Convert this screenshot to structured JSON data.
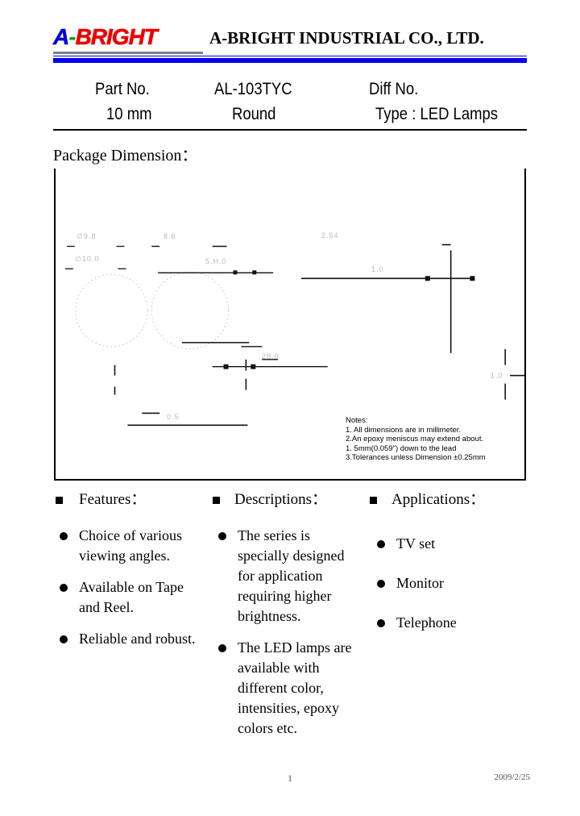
{
  "header": {
    "logo": {
      "part_a": "A",
      "dash": "-",
      "part_bright": "BRIGHT"
    },
    "company_name": "A-BRIGHT INDUSTRIAL CO., LTD."
  },
  "part_info": {
    "row1": {
      "label_part_no": "Part No.",
      "part_number": "AL-103TYC",
      "label_diff_no": "Diff No."
    },
    "row2": {
      "size": "10 mm",
      "shape": "Round",
      "type": "Type : LED Lamps"
    }
  },
  "section": {
    "package_dimension_title": "Package Dimension："
  },
  "drawing": {
    "dim_labels": [
      "∅9.8",
      "∅10.0",
      "8.6",
      "5.H.0",
      "2.54",
      "28.0",
      "1.0",
      "0.5",
      "1.0"
    ],
    "notes": {
      "title": "Notes:",
      "lines": [
        "1. All dimensions are in millimeter.",
        "2.An epoxy meniscus may extend about.",
        "  1. 5mm(0.059\") down to the lead",
        "3.Tolerances unless Dimension ±0.25mm"
      ]
    }
  },
  "columns": {
    "features": {
      "heading": "Features：",
      "items": [
        "Choice of various viewing angles.",
        "Available on Tape and Reel.",
        "Reliable and robust."
      ]
    },
    "descriptions": {
      "heading": "Descriptions：",
      "items": [
        "The series is specially designed for application requiring higher brightness.",
        "The LED lamps are available with different color, intensities, epoxy colors etc."
      ]
    },
    "applications": {
      "heading": "Applications：",
      "items": [
        "TV set",
        "Monitor",
        "Telephone"
      ]
    }
  },
  "footer": {
    "page_number": "1",
    "date": "2009/2/25"
  }
}
